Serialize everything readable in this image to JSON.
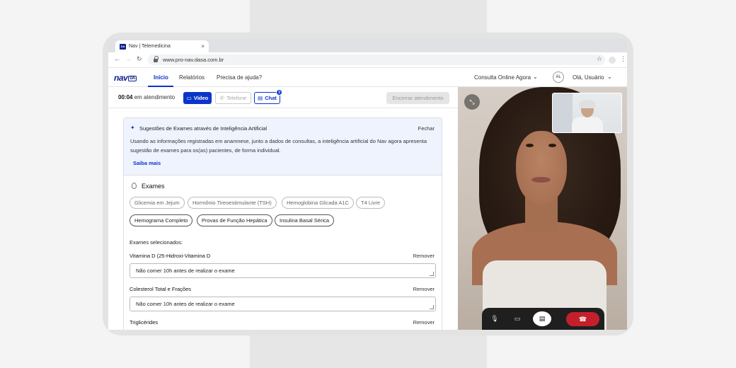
{
  "browser": {
    "tab_title": "Nav | Telemedicina",
    "tab_favicon_text": "DA",
    "url": "www.pro-nav.dasa.com.br"
  },
  "app_nav": {
    "logo": "nav",
    "logo_mark": "DA",
    "links": [
      "Início",
      "Relatórios",
      "Precisa de ajuda?"
    ],
    "active_link": "Início",
    "consulta_label": "Consulta Online Agora",
    "avatar_initials": "AL",
    "user_greeting": "Olá, Usuário"
  },
  "action_bar": {
    "timer": "00:04",
    "timer_suffix": "em atendimento",
    "video_label": "Vídeo",
    "phone_label": "Telefone",
    "chat_label": "Chat",
    "chat_badge": "3",
    "end_label": "Encerrar atendimento"
  },
  "ai_suggestion": {
    "title": "Sugestões de Exames através de Inteligência Artificial",
    "close_label": "Fechar",
    "description": "Usando as informações registradas em anamnese, junto a dados de consultas, a inteligência artificial do Nav agora apresenta sugestão de exames para os(as) pacientes, de forma individual.",
    "more_label": "Saiba mais"
  },
  "exams": {
    "title": "Exames",
    "chips_row1": [
      "Glicemia em Jejum",
      "Hormônio Tireoestimulante (TSH)",
      "Hemoglobina Glicada A1C",
      "T4 Livre"
    ],
    "chips_row2": [
      "Hemograma Completo",
      "Provas de Função Hepática",
      "Insulina Basal Sérica"
    ],
    "selected_label": "Exames selecionados:",
    "remove_label": "Remover",
    "selected": [
      {
        "name": "Vitamina D (25-Hidroxi-Vitamina D",
        "note": "Não comer 10h antes de realizar o exame"
      },
      {
        "name": "Colesterol Total e Frações",
        "note": "Não comer 10h antes de realizar o exame"
      },
      {
        "name": "Triglicérides",
        "note": ""
      }
    ]
  },
  "video": {
    "controls": [
      "microphone-icon",
      "camera-icon",
      "chat-icon",
      "hangup-icon"
    ]
  },
  "colors": {
    "brand_blue": "#0b35c9",
    "hangup_red": "#c4202b"
  }
}
